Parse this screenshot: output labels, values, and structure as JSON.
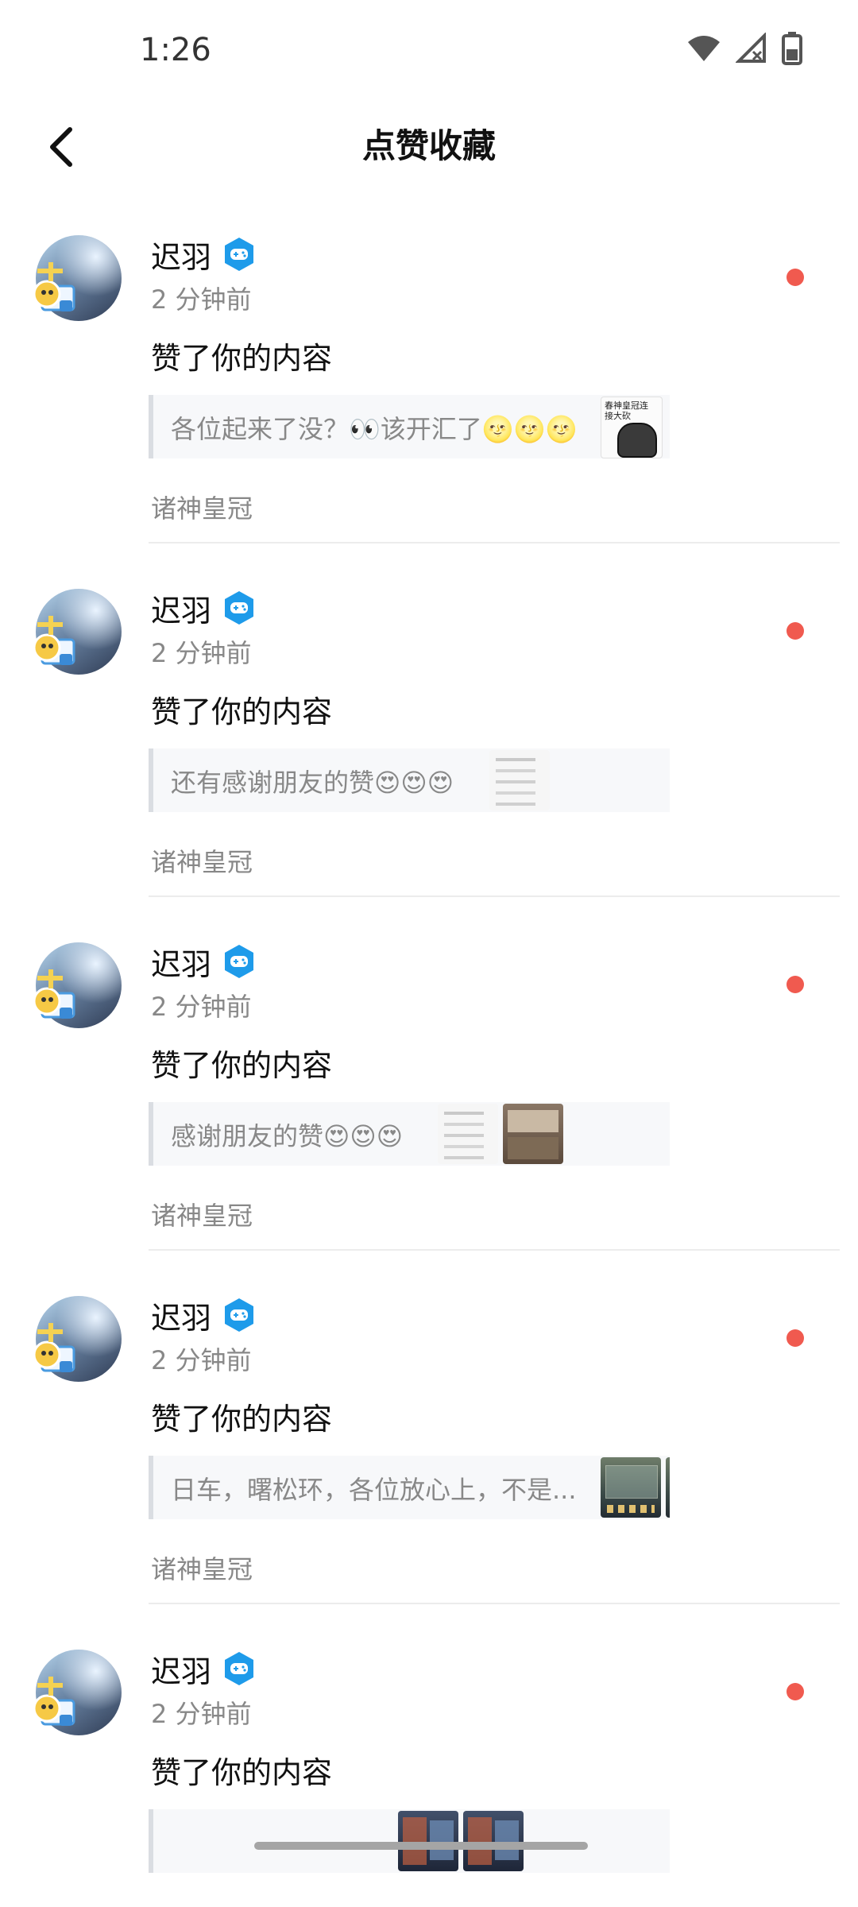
{
  "status_bar": {
    "time": "1:26",
    "icons": [
      "wifi-icon",
      "cellular-no-signal-icon",
      "battery-icon"
    ]
  },
  "header": {
    "title": "点赞收藏",
    "back_icon": "chevron-left-icon"
  },
  "colors": {
    "accent_blue": "#1e9bea",
    "unread_dot": "#f05a4f",
    "secondary_text": "#888888"
  },
  "items": [
    {
      "user": "迟羽",
      "time_ago": "2 分钟前",
      "action": "赞了你的内容",
      "quote": "各位起来了没？👀该开汇了🌝🌝🌝",
      "thumbnails": [
        {
          "kind": "comic",
          "text": "春神皇冠连接大砍"
        }
      ],
      "group": "诸神皇冠"
    },
    {
      "user": "迟羽",
      "time_ago": "2 分钟前",
      "action": "赞了你的内容",
      "quote": "还有感谢朋友的赞😍😍😍",
      "thumbnails": [
        {
          "kind": "light"
        }
      ],
      "group": "诸神皇冠"
    },
    {
      "user": "迟羽",
      "time_ago": "2 分钟前",
      "action": "赞了你的内容",
      "quote": "感谢朋友的赞😍😍😍",
      "thumbnails": [
        {
          "kind": "light"
        },
        {
          "kind": "brown"
        }
      ],
      "group": "诸神皇冠"
    },
    {
      "user": "迟羽",
      "time_ago": "2 分钟前",
      "action": "赞了你的内容",
      "quote": "日车，曙松环，各位放心上，不是...",
      "thumbnails": [
        {
          "kind": "dark"
        },
        {
          "kind": "dark"
        },
        {
          "kind": "dark"
        }
      ],
      "group": "诸神皇冠"
    },
    {
      "user": "迟羽",
      "time_ago": "2 分钟前",
      "action": "赞了你的内容",
      "quote": "",
      "thumbnails": [
        {
          "kind": "game"
        },
        {
          "kind": "game"
        }
      ],
      "group": "诸神皇冠"
    }
  ]
}
